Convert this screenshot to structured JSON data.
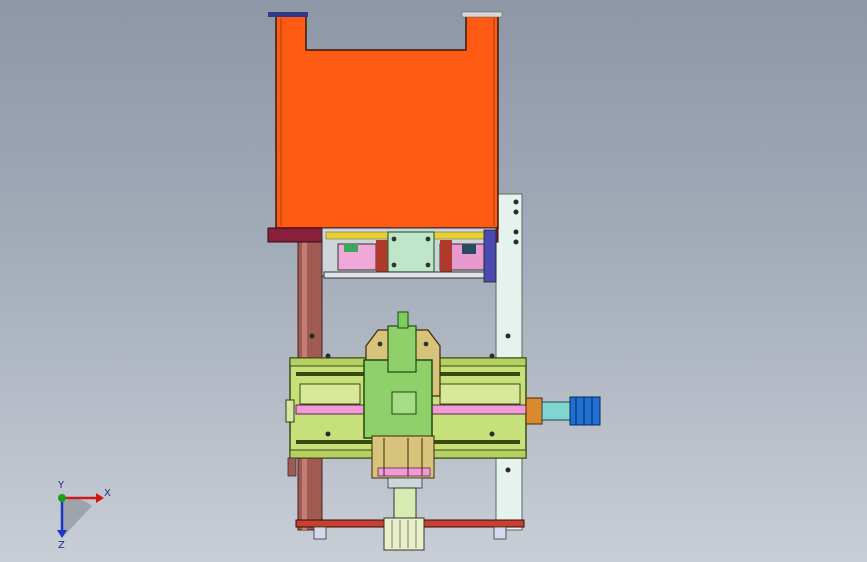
{
  "viewport": {
    "background_top": "#8d97a6",
    "background_bottom": "#c9ced6"
  },
  "triad": {
    "x_label": "X",
    "y_label": "Y",
    "z_label": "Z",
    "x_color": "#d01818",
    "y_color": "#18a018",
    "z_color": "#1838c8"
  },
  "colors": {
    "hopper": "#ff5a14",
    "hopper_base": "#8a1f3c",
    "frame_green": "#c6e07a",
    "carriage_green": "#8fd06a",
    "rail_pink": "#f09ad8",
    "post_brown": "#a05a52",
    "post_white": "#e6f2ee",
    "motor_blue": "#1f6fd0",
    "plate_red": "#c8402f",
    "bracket_tan": "#d8c37a"
  }
}
